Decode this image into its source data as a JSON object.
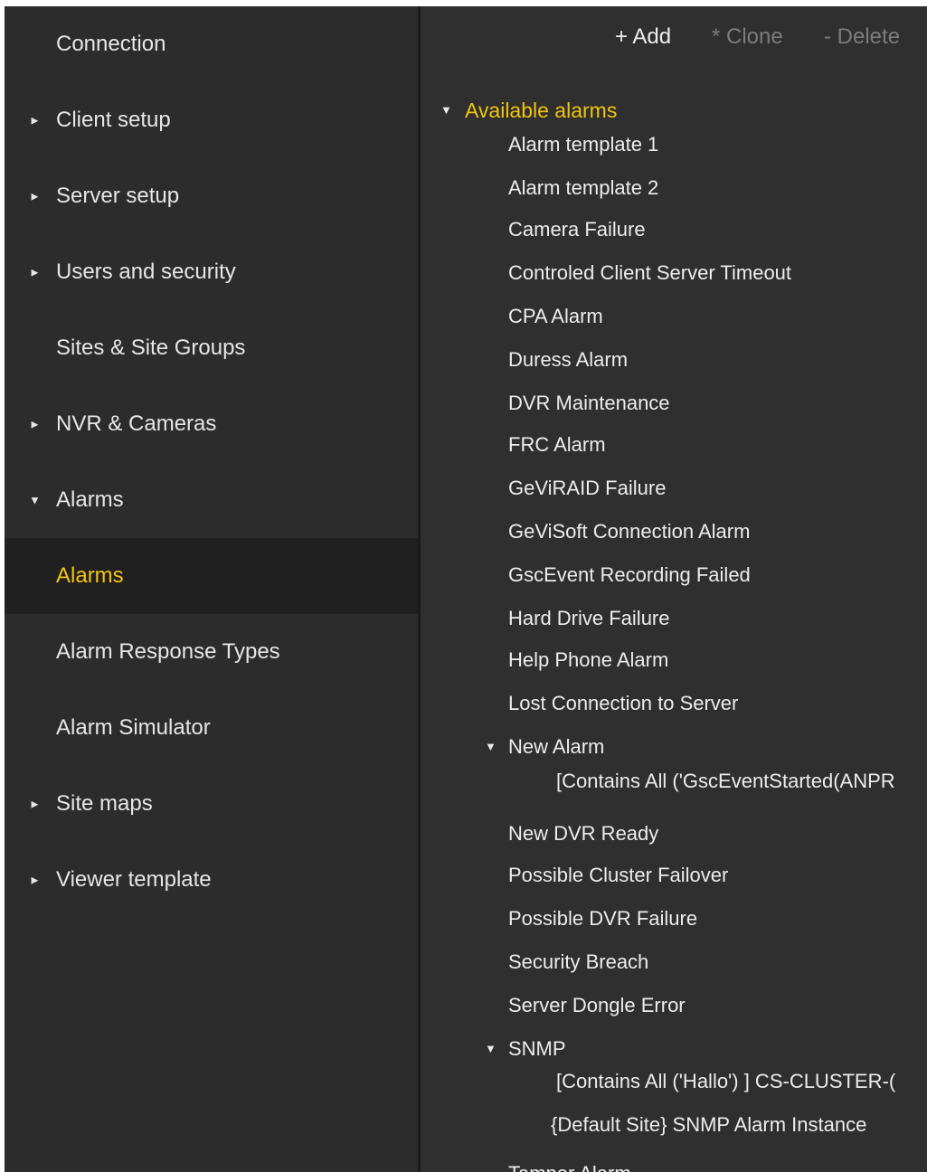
{
  "sidebar": {
    "items": [
      {
        "label": "Connection",
        "arrow": ""
      },
      {
        "label": "Client setup",
        "arrow": "►"
      },
      {
        "label": "Server setup",
        "arrow": "►"
      },
      {
        "label": "Users and security",
        "arrow": "►"
      },
      {
        "label": "Sites & Site Groups",
        "arrow": ""
      },
      {
        "label": "NVR & Cameras",
        "arrow": "►"
      },
      {
        "label": "Alarms",
        "arrow": "▼"
      },
      {
        "label": "Alarms",
        "arrow": ""
      },
      {
        "label": "Alarm Response Types",
        "arrow": ""
      },
      {
        "label": "Alarm Simulator",
        "arrow": ""
      },
      {
        "label": "Site maps",
        "arrow": "►"
      },
      {
        "label": "Viewer template",
        "arrow": "►"
      }
    ]
  },
  "toolbar": {
    "add_label": "+ Add",
    "clone_label": "* Clone",
    "delete_label": "- Delete"
  },
  "tree": {
    "root_label": "Available alarms",
    "root_caret": "▼",
    "items": [
      {
        "label": "Alarm template 1"
      },
      {
        "label": "Alarm template 2"
      },
      {
        "label": "Camera Failure"
      },
      {
        "label": "Controled Client Server Timeout"
      },
      {
        "label": "CPA Alarm"
      },
      {
        "label": "Duress Alarm"
      },
      {
        "label": "DVR Maintenance"
      },
      {
        "label": "FRC Alarm"
      },
      {
        "label": "GeViRAID Failure"
      },
      {
        "label": "GeViSoft Connection Alarm"
      },
      {
        "label": "GscEvent Recording Failed"
      },
      {
        "label": "Hard Drive Failure"
      },
      {
        "label": "Help Phone Alarm"
      },
      {
        "label": "Lost Connection to Server"
      },
      {
        "label": "New Alarm",
        "caret": "▼"
      },
      {
        "label": "[Contains All ('GscEventStarted(ANPR"
      },
      {
        "label": "New DVR Ready"
      },
      {
        "label": "Possible Cluster Failover"
      },
      {
        "label": "Possible DVR Failure"
      },
      {
        "label": "Security Breach"
      },
      {
        "label": "Server Dongle Error"
      },
      {
        "label": "SNMP",
        "caret": "▼"
      },
      {
        "label": "[Contains All ('Hallo') ] CS-CLUSTER-("
      },
      {
        "label": "{Default Site} SNMP Alarm Instance"
      },
      {
        "label": "Tamper Alarm"
      }
    ]
  },
  "colors": {
    "accent": "#f2c40f",
    "sidebar_bg": "#2c2c2c",
    "main_bg": "#2f2f2f",
    "active_bg": "#202020"
  }
}
